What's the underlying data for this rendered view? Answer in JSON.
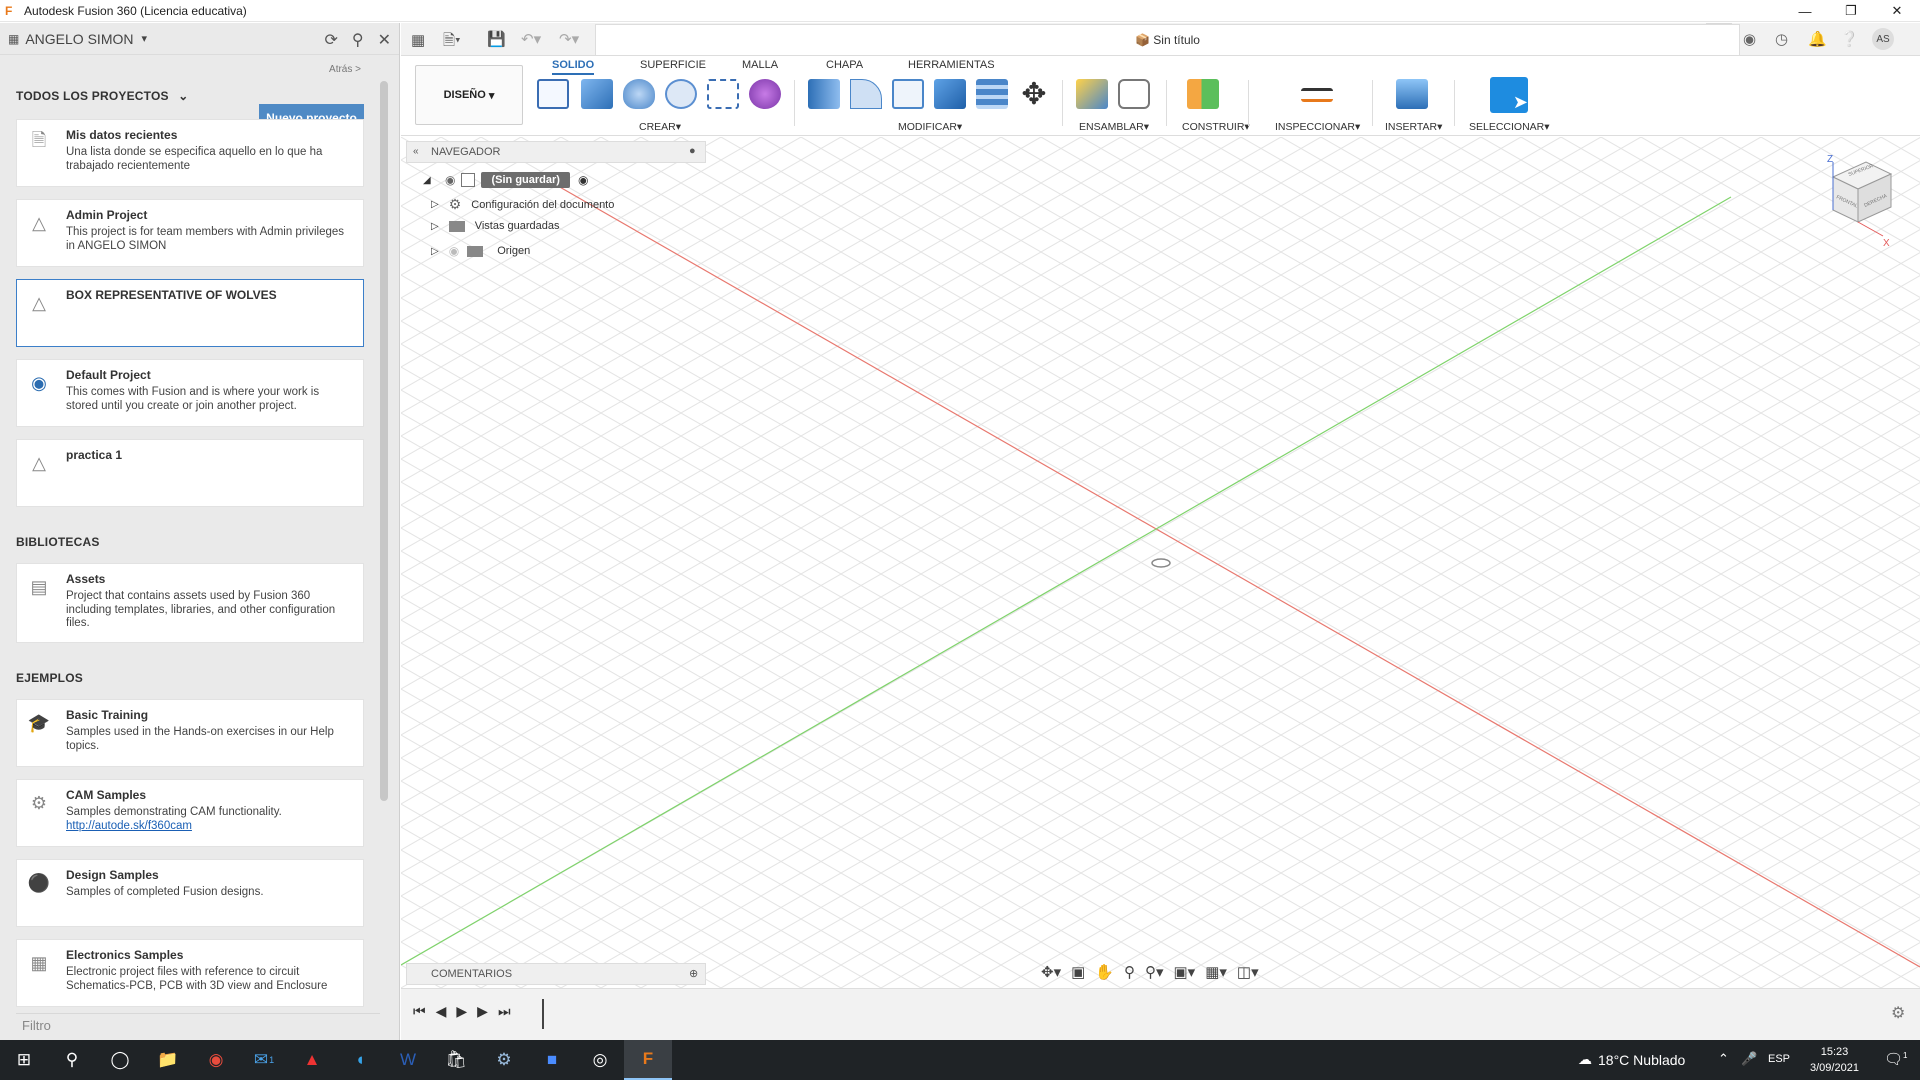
{
  "window": {
    "title": "Autodesk Fusion 360 (Licencia educativa)",
    "app_icon": "F"
  },
  "left_panel": {
    "user": "ANGELO SIMON",
    "back": "Atrás >",
    "projects_header": "TODOS LOS PROYECTOS",
    "new_project": "Nuevo proyecto",
    "projects": [
      {
        "title": "Mis datos recientes",
        "desc": "Una lista donde se especifica aquello en lo que ha trabajado recientemente",
        "icon": "documents-icon"
      },
      {
        "title": "Admin Project",
        "desc": "This project is for team members with Admin privileges in ANGELO SIMON",
        "icon": "project-icon"
      },
      {
        "title": "BOX REPRESENTATIVE OF WOLVES",
        "desc": "",
        "icon": "project-icon"
      },
      {
        "title": "Default Project",
        "desc": "This comes with Fusion and is where your work is stored until you create or join another project.",
        "icon": "default-project-icon"
      },
      {
        "title": "practica 1",
        "desc": "",
        "icon": "project-icon"
      }
    ],
    "libraries_header": "BIBLIOTECAS",
    "libraries": [
      {
        "title": "Assets",
        "desc": "Project that contains assets used by Fusion 360 including templates, libraries, and other configuration files.",
        "icon": "archive-icon"
      }
    ],
    "examples_header": "EJEMPLOS",
    "examples": [
      {
        "title": "Basic Training",
        "desc": "Samples used in the Hands-on exercises in our Help topics.",
        "icon": "graduation-cap-icon"
      },
      {
        "title": "CAM Samples",
        "desc": "Samples demonstrating CAM functionality.",
        "link": "http://autode.sk/f360cam",
        "icon": "cam-machine-icon"
      },
      {
        "title": "Design Samples",
        "desc": "Samples of completed Fusion designs.",
        "icon": "design-sample-icon"
      },
      {
        "title": "Electronics Samples",
        "desc": "Electronic project files with reference to circuit Schematics-PCB, PCB with 3D view and Enclosure",
        "icon": "electronics-icon"
      }
    ],
    "filter_placeholder": "Filtro"
  },
  "document": {
    "name": "Sin título"
  },
  "ribbon": {
    "tabs": [
      "SOLIDO",
      "SUPERFICIE",
      "MALLA",
      "CHAPA",
      "HERRAMIENTAS"
    ],
    "active_tab": "SOLIDO",
    "workspace": "DISEÑO",
    "groups": [
      "CREAR",
      "MODIFICAR",
      "ENSAMBLAR",
      "CONSTRUIR",
      "INSPECCIONAR",
      "INSERTAR",
      "SELECCIONAR"
    ]
  },
  "browser": {
    "title": "NAVEGADOR",
    "root": "(Sin guardar)",
    "items": [
      "Configuración del documento",
      "Vistas guardadas",
      "Origen"
    ]
  },
  "viewcube": {
    "faces": [
      "SUPERIOR",
      "FRONTAL",
      "DERECHA"
    ],
    "axes": [
      "Z",
      "X"
    ]
  },
  "comments": {
    "title": "COMENTARIOS"
  },
  "taskbar": {
    "weather": "18°C  Nublado",
    "lang": "ESP",
    "time": "15:23",
    "date": "3/09/2021",
    "notif_count": "1",
    "mail_count": "1"
  },
  "colors": {
    "accent": "#4f8ac5",
    "x_axis": "#e8786f",
    "y_axis": "#7fd36b",
    "taskbar": "#1f2326"
  }
}
